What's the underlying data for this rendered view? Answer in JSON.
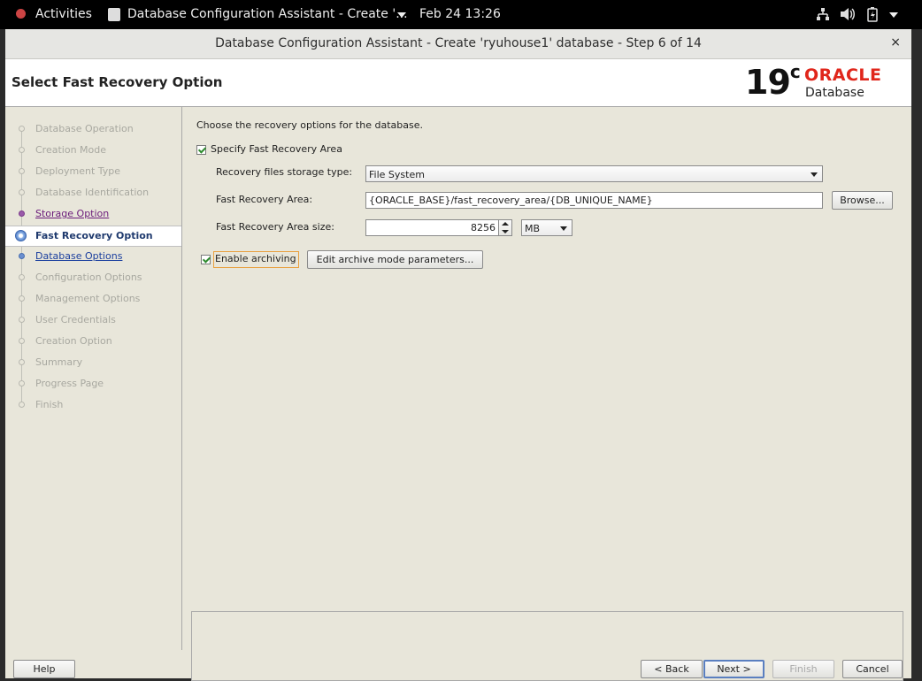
{
  "topbar": {
    "activities": "Activities",
    "app_title": "Database Configuration Assistant - Create '...",
    "datetime": "Feb 24  13:26"
  },
  "window": {
    "title": "Database Configuration Assistant - Create 'ryuhouse1' database - Step 6 of 14",
    "close_glyph": "×"
  },
  "header": {
    "page_title": "Select Fast Recovery Option",
    "logo_version": "19",
    "logo_sup": "c",
    "logo_brand": "ORACLE",
    "logo_product": "Database",
    "brand_color": "#e0261b"
  },
  "nav": {
    "items": [
      {
        "label": "Database Operation",
        "state": "disabled"
      },
      {
        "label": "Creation Mode",
        "state": "disabled"
      },
      {
        "label": "Deployment Type",
        "state": "disabled"
      },
      {
        "label": "Database Identification",
        "state": "disabled"
      },
      {
        "label": "Storage Option",
        "state": "visited"
      },
      {
        "label": "Fast Recovery Option",
        "state": "current"
      },
      {
        "label": "Database Options",
        "state": "link"
      },
      {
        "label": "Configuration Options",
        "state": "disabled"
      },
      {
        "label": "Management Options",
        "state": "disabled"
      },
      {
        "label": "User Credentials",
        "state": "disabled"
      },
      {
        "label": "Creation Option",
        "state": "disabled"
      },
      {
        "label": "Summary",
        "state": "disabled"
      },
      {
        "label": "Progress Page",
        "state": "disabled"
      },
      {
        "label": "Finish",
        "state": "disabled"
      }
    ]
  },
  "content": {
    "intro": "Choose the recovery options for the database.",
    "specify_fra": {
      "label": "Specify Fast Recovery Area",
      "checked": true
    },
    "storage_type": {
      "label": "Recovery files storage type:",
      "value": "File System"
    },
    "fra_path": {
      "label": "Fast Recovery Area:",
      "value": "{ORACLE_BASE}/fast_recovery_area/{DB_UNIQUE_NAME}",
      "browse_label": "Browse..."
    },
    "fra_size": {
      "label": "Fast Recovery Area size:",
      "value": "8256",
      "unit": "MB"
    },
    "archiving": {
      "label": "Enable archiving",
      "checked": true,
      "edit_label": "Edit archive mode parameters..."
    }
  },
  "footer": {
    "help": "Help",
    "back": "< Back",
    "next": "Next >",
    "finish": "Finish",
    "cancel": "Cancel"
  }
}
